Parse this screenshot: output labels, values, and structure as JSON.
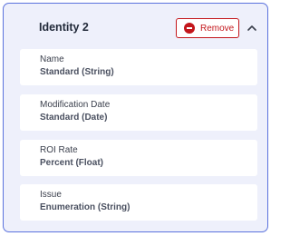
{
  "section": {
    "title": "Identity 2",
    "remove_label": "Remove"
  },
  "fields": [
    {
      "label": "Name",
      "value": "Standard (String)"
    },
    {
      "label": "Modification Date",
      "value": "Standard (Date)"
    },
    {
      "label": "ROI Rate",
      "value": "Percent (Float)"
    },
    {
      "label": "Issue",
      "value": "Enumeration (String)"
    }
  ],
  "colors": {
    "accent_border": "#5b72dd",
    "panel_background": "#eef0fb",
    "danger": "#c3161b"
  },
  "icons": {
    "remove": "minus-circle-icon",
    "collapse": "chevron-up-icon"
  }
}
